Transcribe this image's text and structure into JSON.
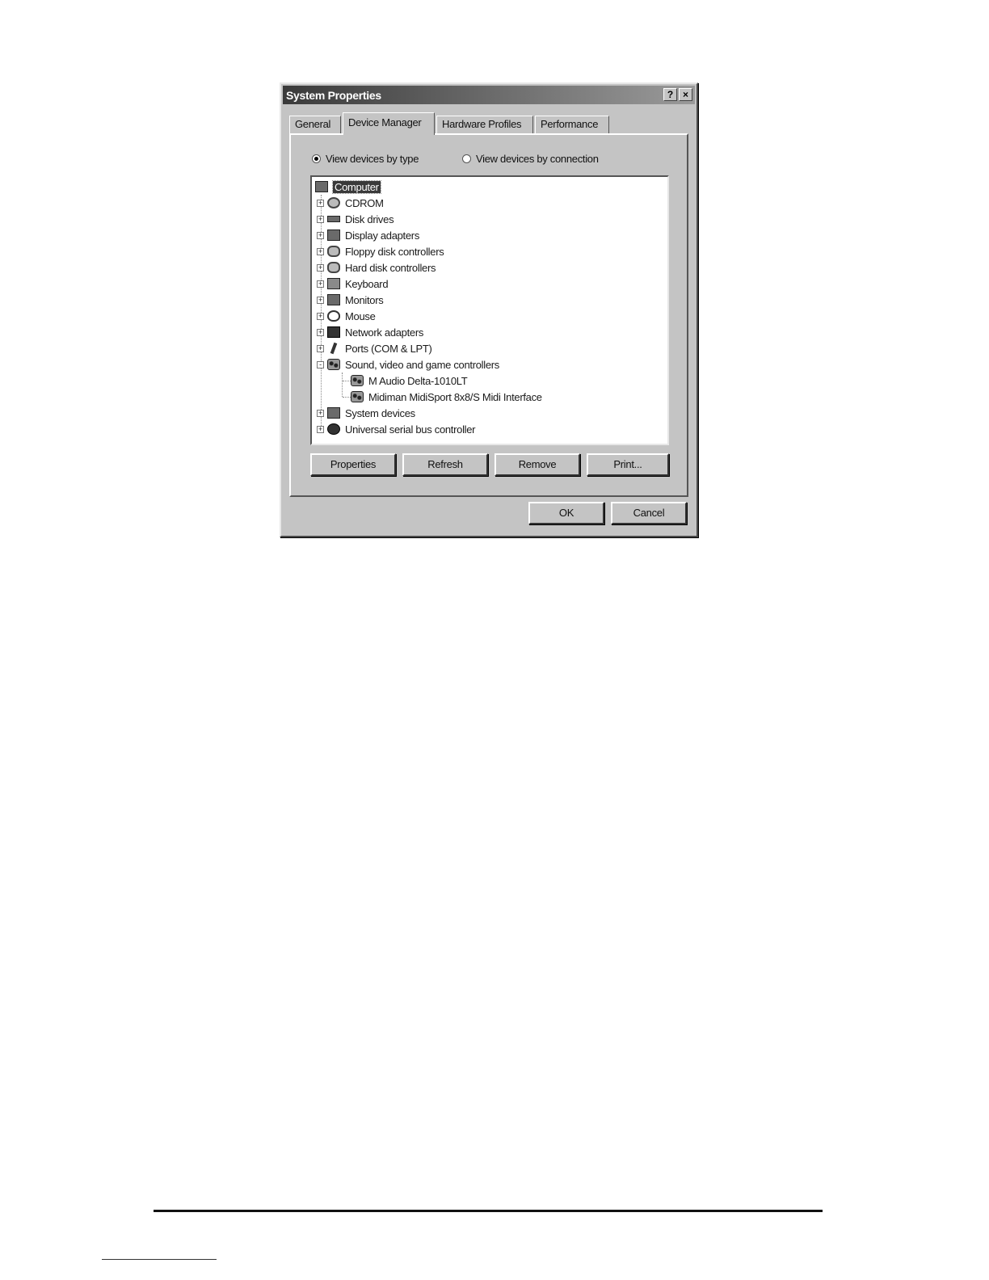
{
  "window": {
    "title": "System Properties",
    "help_label": "?",
    "close_label": "×"
  },
  "tabs": [
    {
      "label": "General"
    },
    {
      "label": "Device Manager"
    },
    {
      "label": "Hardware Profiles"
    },
    {
      "label": "Performance"
    }
  ],
  "view_options": {
    "by_type": "View devices by type",
    "by_connection": "View devices by connection",
    "selected": "by_type"
  },
  "tree": {
    "root": "Computer",
    "items": [
      {
        "label": "CDROM",
        "icon": "cdrom-icon",
        "expander": "+"
      },
      {
        "label": "Disk drives",
        "icon": "disk-drive-icon",
        "expander": "+"
      },
      {
        "label": "Display adapters",
        "icon": "display-adapter-icon",
        "expander": "+"
      },
      {
        "label": "Floppy disk controllers",
        "icon": "floppy-controller-icon",
        "expander": "+"
      },
      {
        "label": "Hard disk controllers",
        "icon": "hard-disk-controller-icon",
        "expander": "+"
      },
      {
        "label": "Keyboard",
        "icon": "keyboard-icon",
        "expander": "+"
      },
      {
        "label": "Monitors",
        "icon": "monitor-icon",
        "expander": "+"
      },
      {
        "label": "Mouse",
        "icon": "mouse-icon",
        "expander": "+"
      },
      {
        "label": "Network adapters",
        "icon": "network-adapter-icon",
        "expander": "+"
      },
      {
        "label": "Ports (COM & LPT)",
        "icon": "port-icon",
        "expander": "+"
      },
      {
        "label": "Sound, video and game controllers",
        "icon": "sound-controller-icon",
        "expander": "-"
      },
      {
        "label": "M Audio Delta-1010LT",
        "icon": "sound-device-icon",
        "expander": ""
      },
      {
        "label": "Midiman MidiSport 8x8/S Midi Interface",
        "icon": "sound-device-icon",
        "expander": ""
      },
      {
        "label": "System devices",
        "icon": "system-devices-icon",
        "expander": "+"
      },
      {
        "label": "Universal serial bus controller",
        "icon": "usb-icon",
        "expander": "+"
      }
    ]
  },
  "buttons": {
    "properties": "Properties",
    "refresh": "Refresh",
    "remove": "Remove",
    "print": "Print...",
    "ok": "OK",
    "cancel": "Cancel"
  }
}
